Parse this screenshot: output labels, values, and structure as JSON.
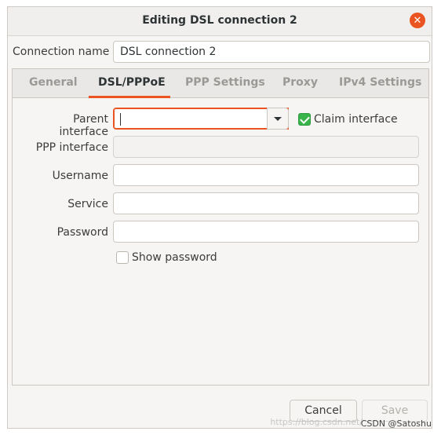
{
  "window": {
    "title": "Editing DSL connection 2",
    "close_icon": "close-icon"
  },
  "connection": {
    "name_label": "Connection name",
    "name_value": "DSL connection 2"
  },
  "tabs": [
    {
      "label": "General"
    },
    {
      "label": "DSL/PPPoE"
    },
    {
      "label": "PPP Settings"
    },
    {
      "label": "Proxy"
    },
    {
      "label": "IPv4 Settings"
    }
  ],
  "active_tab": "DSL/PPPoE",
  "form": {
    "parent_interface_label": "Parent interface",
    "parent_interface_value": "",
    "claim_interface_label": "Claim interface",
    "claim_interface_checked": true,
    "ppp_interface_label": "PPP interface",
    "ppp_interface_value": "",
    "username_label": "Username",
    "username_value": "",
    "service_label": "Service",
    "service_value": "",
    "password_label": "Password",
    "password_value": "",
    "show_password_label": "Show password",
    "show_password_checked": false
  },
  "buttons": {
    "cancel": "Cancel",
    "save": "Save"
  },
  "watermark": {
    "text": "https://blog.csdn.net/",
    "credit": "CSDN @Satoshu"
  },
  "colors": {
    "accent": "#e95420",
    "check": "#38b44a"
  }
}
